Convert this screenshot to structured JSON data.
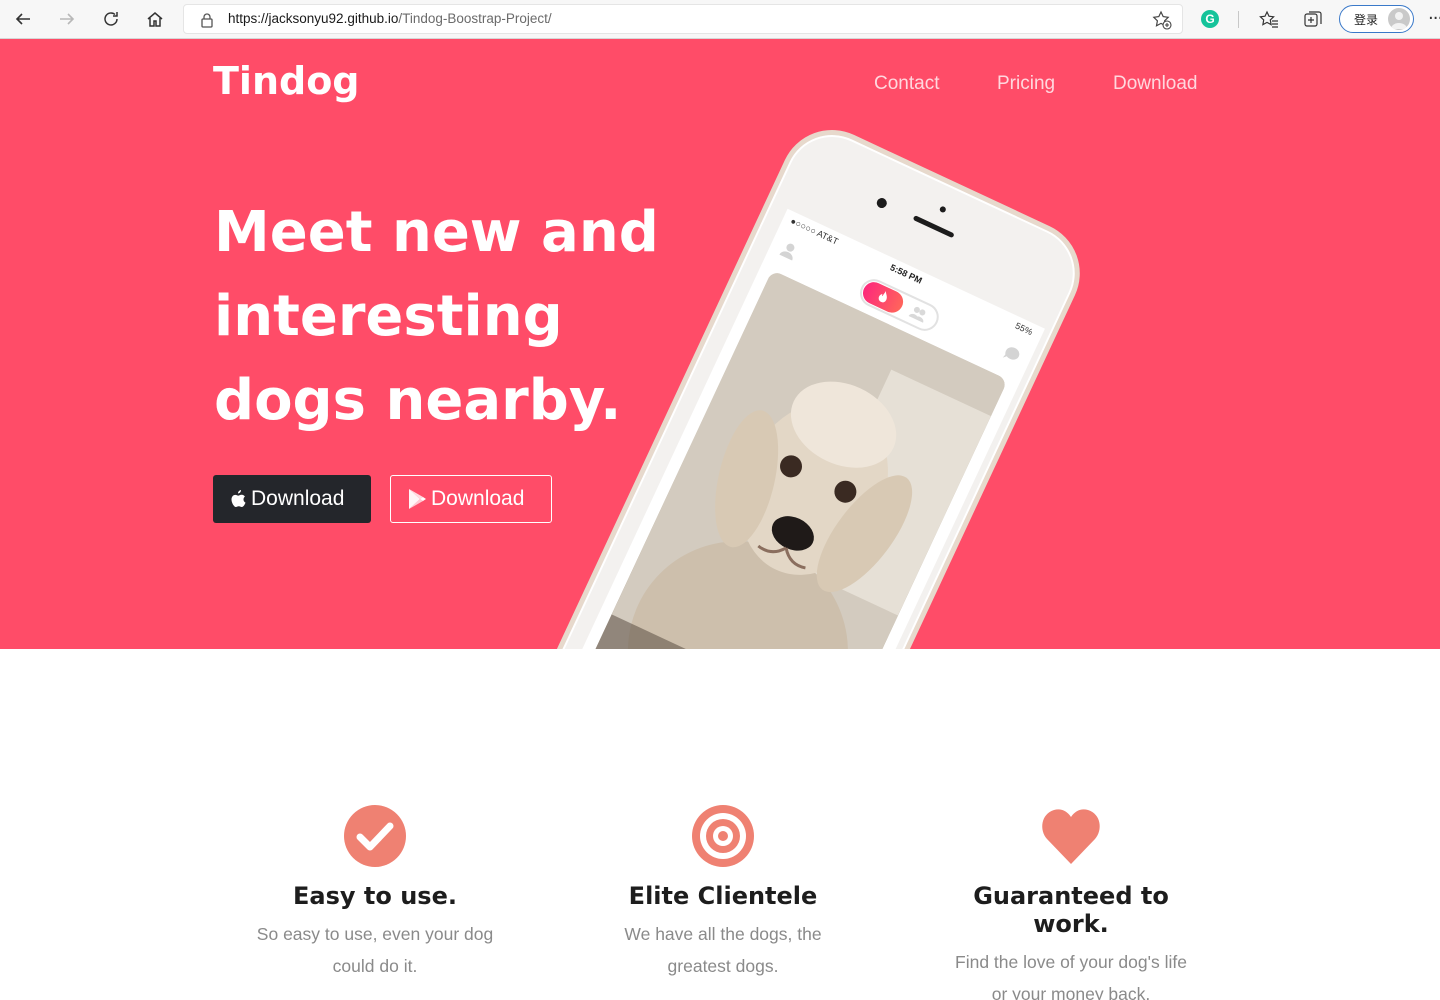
{
  "browser": {
    "url_host": "https://jacksonyu92.github.io",
    "url_path": "/Tindog-Boostrap-Project/",
    "grammarly_letter": "G",
    "login_label": "登录",
    "more_label": "···"
  },
  "nav": {
    "brand": "Tindog",
    "links": [
      "Contact",
      "Pricing",
      "Download"
    ]
  },
  "hero": {
    "headline": "Meet new and interesting dogs nearby.",
    "buttons": {
      "apple_label": "Download",
      "play_label": "Download"
    },
    "phone": {
      "carrier": "●○○○○ AT&T",
      "time": "5:58 PM",
      "battery": "55%"
    }
  },
  "features": [
    {
      "title": "Easy to use.",
      "text": "So easy to use, even your dog could do it.",
      "icon": "check-circle-icon"
    },
    {
      "title": "Elite Clientele",
      "text": "We have all the dogs, the greatest dogs.",
      "icon": "bullseye-icon"
    },
    {
      "title": "Guaranteed to work.",
      "text": "Find the love of your dog's life or your money back.",
      "icon": "heart-icon"
    }
  ],
  "colors": {
    "hero_bg": "#ff4c68",
    "accent": "#ef8172",
    "dark_button": "#24262b"
  }
}
